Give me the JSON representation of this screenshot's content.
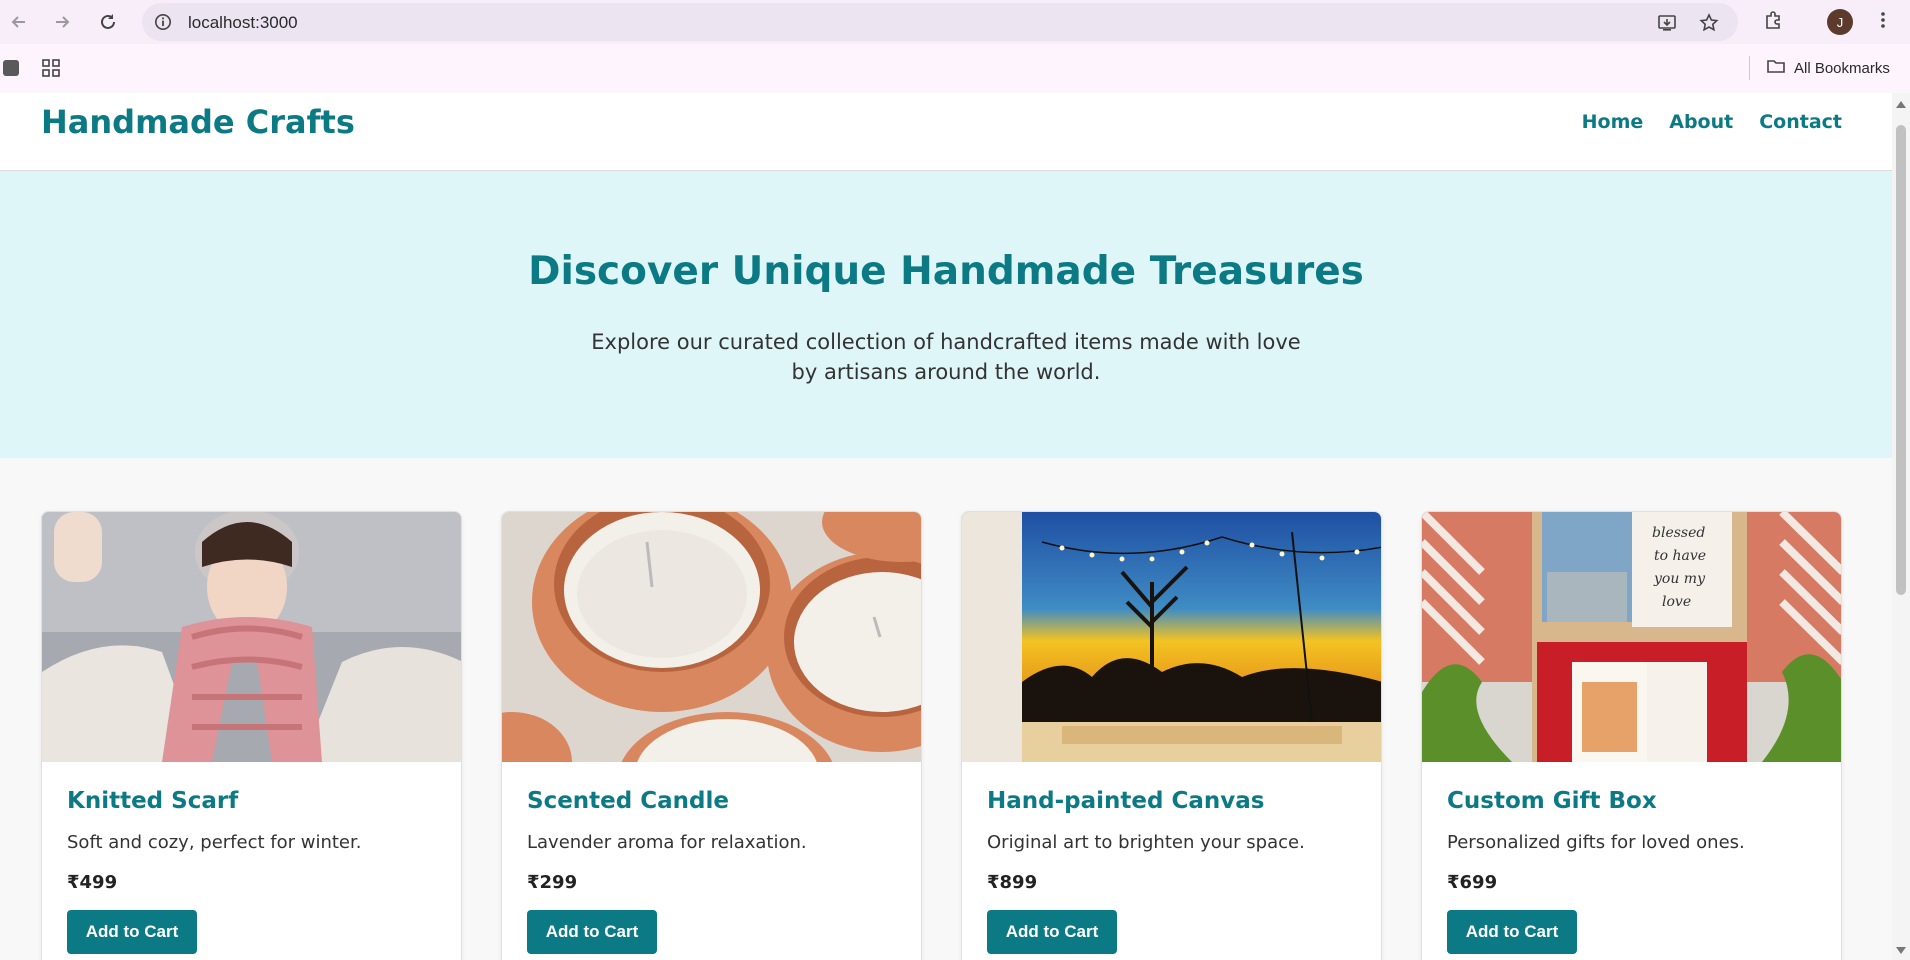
{
  "browser": {
    "url": "localhost:3000",
    "avatar_initial": "J",
    "all_bookmarks_label": "All Bookmarks",
    "icons": [
      "back-arrow-icon",
      "forward-arrow-icon",
      "reload-icon",
      "site-info-icon",
      "install-app-icon",
      "star-icon",
      "extensions-icon",
      "kebab-menu-icon",
      "apps-grid-icon",
      "folder-icon"
    ]
  },
  "header": {
    "logo": "Handmade Crafts",
    "nav": [
      "Home",
      "About",
      "Contact"
    ]
  },
  "hero": {
    "title": "Discover Unique Handmade Treasures",
    "subtitle": "Explore our curated collection of handcrafted items made with love by artisans around the world."
  },
  "products": [
    {
      "name": "Knitted Scarf",
      "description": "Soft and cozy, perfect for winter.",
      "price": "₹499",
      "button": "Add to Cart",
      "image": "photo of woman wearing pink knitted scarf"
    },
    {
      "name": "Scented Candle",
      "description": "Lavender aroma for relaxation.",
      "price": "₹299",
      "button": "Add to Cart",
      "image": "photo of candles in terracotta pots"
    },
    {
      "name": "Hand-painted Canvas",
      "description": "Original art to brighten your space.",
      "price": "₹899",
      "button": "Add to Cart",
      "image": "photo of small painted sunset canvas on easel"
    },
    {
      "name": "Custom Gift Box",
      "description": "Personalized gifts for loved ones.",
      "price": "₹699",
      "button": "Add to Cart",
      "image": "photo of personalized gift box with cards"
    }
  ],
  "colors": {
    "accent": "#0c7a85",
    "hero_bg": "#dff6f8",
    "page_bg": "#f8f8f8"
  }
}
